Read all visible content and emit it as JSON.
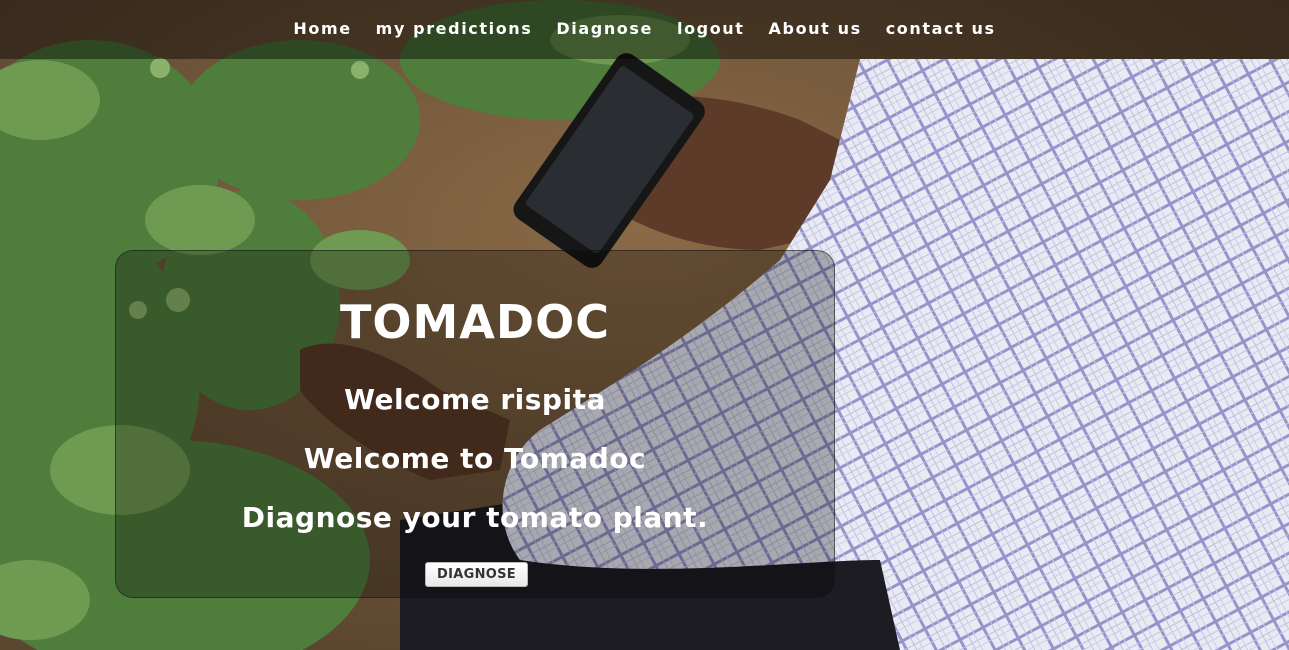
{
  "nav": {
    "items": [
      {
        "label": "Home"
      },
      {
        "label": "my predictions"
      },
      {
        "label": "Diagnose"
      },
      {
        "label": "logout"
      },
      {
        "label": "About us"
      },
      {
        "label": "contact us"
      }
    ]
  },
  "hero": {
    "title": "TOMADOC",
    "welcome_user": "Welcome rispita",
    "welcome_app": "Welcome to Tomadoc",
    "tagline": "Diagnose your tomato plant.",
    "button_label": "DIAGNOSE"
  },
  "colors": {
    "nav_background": "#000000",
    "text": "#ffffff",
    "button_text": "#333333"
  }
}
